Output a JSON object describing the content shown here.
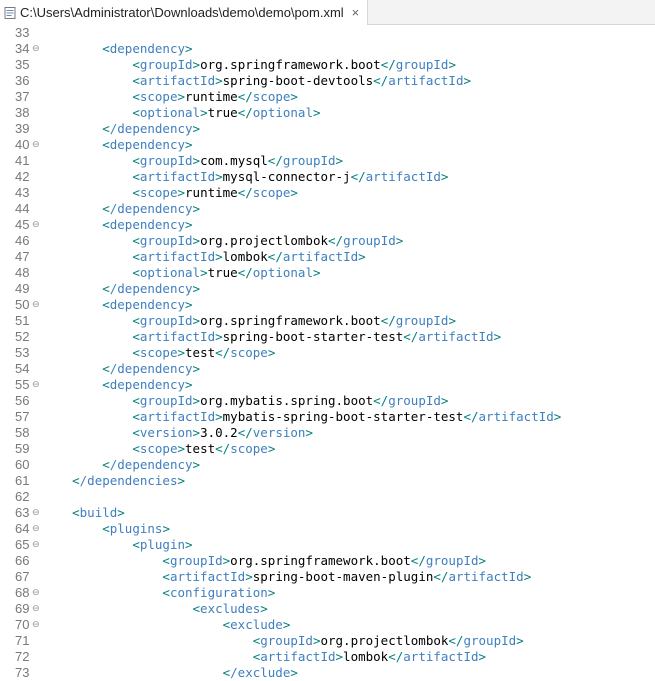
{
  "tab": {
    "title": "C:\\Users\\Administrator\\Downloads\\demo\\demo\\pom.xml",
    "close_glyph": "×",
    "icon": "xml-file-icon"
  },
  "fold_glyph": "⊖",
  "lines": [
    {
      "n": "33",
      "fold": false,
      "indent": "",
      "tag": "",
      "text": "",
      "close": false
    },
    {
      "n": "34",
      "fold": true,
      "indent": "        ",
      "tag": "dependency",
      "text": "",
      "close": false
    },
    {
      "n": "35",
      "fold": false,
      "indent": "            ",
      "tag": "groupId",
      "text": "org.springframework.boot",
      "close": true
    },
    {
      "n": "36",
      "fold": false,
      "indent": "            ",
      "tag": "artifactId",
      "text": "spring-boot-devtools",
      "close": true
    },
    {
      "n": "37",
      "fold": false,
      "indent": "            ",
      "tag": "scope",
      "text": "runtime",
      "close": true
    },
    {
      "n": "38",
      "fold": false,
      "indent": "            ",
      "tag": "optional",
      "text": "true",
      "close": true
    },
    {
      "n": "39",
      "fold": false,
      "indent": "        ",
      "tag": "/dependency",
      "text": "",
      "close": false
    },
    {
      "n": "40",
      "fold": true,
      "indent": "        ",
      "tag": "dependency",
      "text": "",
      "close": false
    },
    {
      "n": "41",
      "fold": false,
      "indent": "            ",
      "tag": "groupId",
      "text": "com.mysql",
      "close": true
    },
    {
      "n": "42",
      "fold": false,
      "indent": "            ",
      "tag": "artifactId",
      "text": "mysql-connector-j",
      "close": true
    },
    {
      "n": "43",
      "fold": false,
      "indent": "            ",
      "tag": "scope",
      "text": "runtime",
      "close": true
    },
    {
      "n": "44",
      "fold": false,
      "indent": "        ",
      "tag": "/dependency",
      "text": "",
      "close": false
    },
    {
      "n": "45",
      "fold": true,
      "indent": "        ",
      "tag": "dependency",
      "text": "",
      "close": false
    },
    {
      "n": "46",
      "fold": false,
      "indent": "            ",
      "tag": "groupId",
      "text": "org.projectlombok",
      "close": true
    },
    {
      "n": "47",
      "fold": false,
      "indent": "            ",
      "tag": "artifactId",
      "text": "lombok",
      "close": true
    },
    {
      "n": "48",
      "fold": false,
      "indent": "            ",
      "tag": "optional",
      "text": "true",
      "close": true
    },
    {
      "n": "49",
      "fold": false,
      "indent": "        ",
      "tag": "/dependency",
      "text": "",
      "close": false
    },
    {
      "n": "50",
      "fold": true,
      "indent": "        ",
      "tag": "dependency",
      "text": "",
      "close": false
    },
    {
      "n": "51",
      "fold": false,
      "indent": "            ",
      "tag": "groupId",
      "text": "org.springframework.boot",
      "close": true
    },
    {
      "n": "52",
      "fold": false,
      "indent": "            ",
      "tag": "artifactId",
      "text": "spring-boot-starter-test",
      "close": true
    },
    {
      "n": "53",
      "fold": false,
      "indent": "            ",
      "tag": "scope",
      "text": "test",
      "close": true
    },
    {
      "n": "54",
      "fold": false,
      "indent": "        ",
      "tag": "/dependency",
      "text": "",
      "close": false
    },
    {
      "n": "55",
      "fold": true,
      "indent": "        ",
      "tag": "dependency",
      "text": "",
      "close": false
    },
    {
      "n": "56",
      "fold": false,
      "indent": "            ",
      "tag": "groupId",
      "text": "org.mybatis.spring.boot",
      "close": true
    },
    {
      "n": "57",
      "fold": false,
      "indent": "            ",
      "tag": "artifactId",
      "text": "mybatis-spring-boot-starter-test",
      "close": true
    },
    {
      "n": "58",
      "fold": false,
      "indent": "            ",
      "tag": "version",
      "text": "3.0.2",
      "close": true
    },
    {
      "n": "59",
      "fold": false,
      "indent": "            ",
      "tag": "scope",
      "text": "test",
      "close": true
    },
    {
      "n": "60",
      "fold": false,
      "indent": "        ",
      "tag": "/dependency",
      "text": "",
      "close": false
    },
    {
      "n": "61",
      "fold": false,
      "indent": "    ",
      "tag": "/dependencies",
      "text": "",
      "close": false
    },
    {
      "n": "62",
      "fold": false,
      "indent": "",
      "tag": "",
      "text": "",
      "close": false
    },
    {
      "n": "63",
      "fold": true,
      "indent": "    ",
      "tag": "build",
      "text": "",
      "close": false
    },
    {
      "n": "64",
      "fold": true,
      "indent": "        ",
      "tag": "plugins",
      "text": "",
      "close": false
    },
    {
      "n": "65",
      "fold": true,
      "indent": "            ",
      "tag": "plugin",
      "text": "",
      "close": false
    },
    {
      "n": "66",
      "fold": false,
      "indent": "                ",
      "tag": "groupId",
      "text": "org.springframework.boot",
      "close": true
    },
    {
      "n": "67",
      "fold": false,
      "indent": "                ",
      "tag": "artifactId",
      "text": "spring-boot-maven-plugin",
      "close": true
    },
    {
      "n": "68",
      "fold": true,
      "indent": "                ",
      "tag": "configuration",
      "text": "",
      "close": false
    },
    {
      "n": "69",
      "fold": true,
      "indent": "                    ",
      "tag": "excludes",
      "text": "",
      "close": false
    },
    {
      "n": "70",
      "fold": true,
      "indent": "                        ",
      "tag": "exclude",
      "text": "",
      "close": false
    },
    {
      "n": "71",
      "fold": false,
      "indent": "                            ",
      "tag": "groupId",
      "text": "org.projectlombok",
      "close": true
    },
    {
      "n": "72",
      "fold": false,
      "indent": "                            ",
      "tag": "artifactId",
      "text": "lombok",
      "close": true
    },
    {
      "n": "73",
      "fold": false,
      "indent": "                        ",
      "tag": "/exclude",
      "text": "",
      "close": false
    }
  ],
  "colors": {
    "bracket": "#008080",
    "tag": "#3f7fbf",
    "text": "#000000",
    "line_number": "#787878"
  }
}
